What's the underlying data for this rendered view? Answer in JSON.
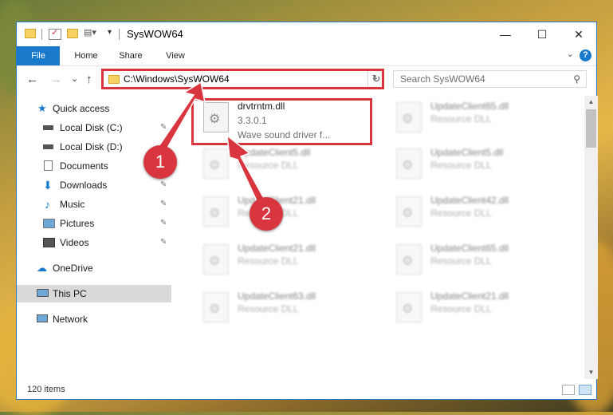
{
  "window": {
    "title": "SysWOW64",
    "controls": {
      "minimize": "—",
      "maximize": "☐",
      "close": "✕"
    }
  },
  "ribbon": {
    "tabs": [
      "File",
      "Home",
      "Share",
      "View"
    ],
    "collapse": "⌄",
    "help": "?"
  },
  "navbar": {
    "back": "←",
    "forward": "→",
    "recent": "⌄",
    "up": "↑",
    "address": "C:\\Windows\\SysWOW64",
    "address_dropdown": "⌄",
    "refresh": "↻",
    "search_placeholder": "Search SysWOW64",
    "search_icon": "search-icon"
  },
  "sidebar": {
    "items": [
      {
        "label": "Quick access",
        "icon": "star-icon",
        "pinned": false
      },
      {
        "label": "Local Disk (C:)",
        "icon": "drive-icon",
        "pinned": true
      },
      {
        "label": "Local Disk (D:)",
        "icon": "drive-icon",
        "pinned": false
      },
      {
        "label": "Documents",
        "icon": "documents-icon",
        "pinned": true
      },
      {
        "label": "Downloads",
        "icon": "download-icon",
        "pinned": true
      },
      {
        "label": "Music",
        "icon": "music-icon",
        "pinned": true
      },
      {
        "label": "Pictures",
        "icon": "pictures-icon",
        "pinned": true
      },
      {
        "label": "Videos",
        "icon": "videos-icon",
        "pinned": true
      },
      {
        "label": "OneDrive",
        "icon": "cloud-icon",
        "pinned": false
      },
      {
        "label": "This PC",
        "icon": "computer-icon",
        "pinned": false,
        "selected": true
      },
      {
        "label": "Network",
        "icon": "network-icon",
        "pinned": false
      }
    ],
    "pin_glyph": "📌"
  },
  "files": [
    {
      "name": "drvtrntm.dll",
      "line2": "3.3.0.1",
      "line3": "Wave sound driver f...",
      "highlighted": true
    },
    {
      "name": "UpdateClient65.dll",
      "line2": "Resource DLL"
    },
    {
      "name": "UpdateClient5.dll",
      "line2": "Resource DLL"
    },
    {
      "name": "UpdateClient5.dll",
      "line2": "Resource DLL"
    },
    {
      "name": "UpdateClient21.dll",
      "line2": "Resource DLL"
    },
    {
      "name": "UpdateClient42.dll",
      "line2": "Resource DLL"
    },
    {
      "name": "UpdateClient21.dll",
      "line2": "Resource DLL"
    },
    {
      "name": "UpdateClient65.dll",
      "line2": "Resource DLL"
    },
    {
      "name": "UpdateClient63.dll",
      "line2": "Resource DLL"
    },
    {
      "name": "UpdateClient21.dll",
      "line2": "Resource DLL"
    }
  ],
  "status": {
    "items_count": "120 items"
  },
  "annotations": {
    "badge1": "1",
    "badge2": "2"
  },
  "colors": {
    "accent": "#1979ca",
    "highlight": "#d9353f",
    "selected_nav": "#d9d9d9"
  }
}
